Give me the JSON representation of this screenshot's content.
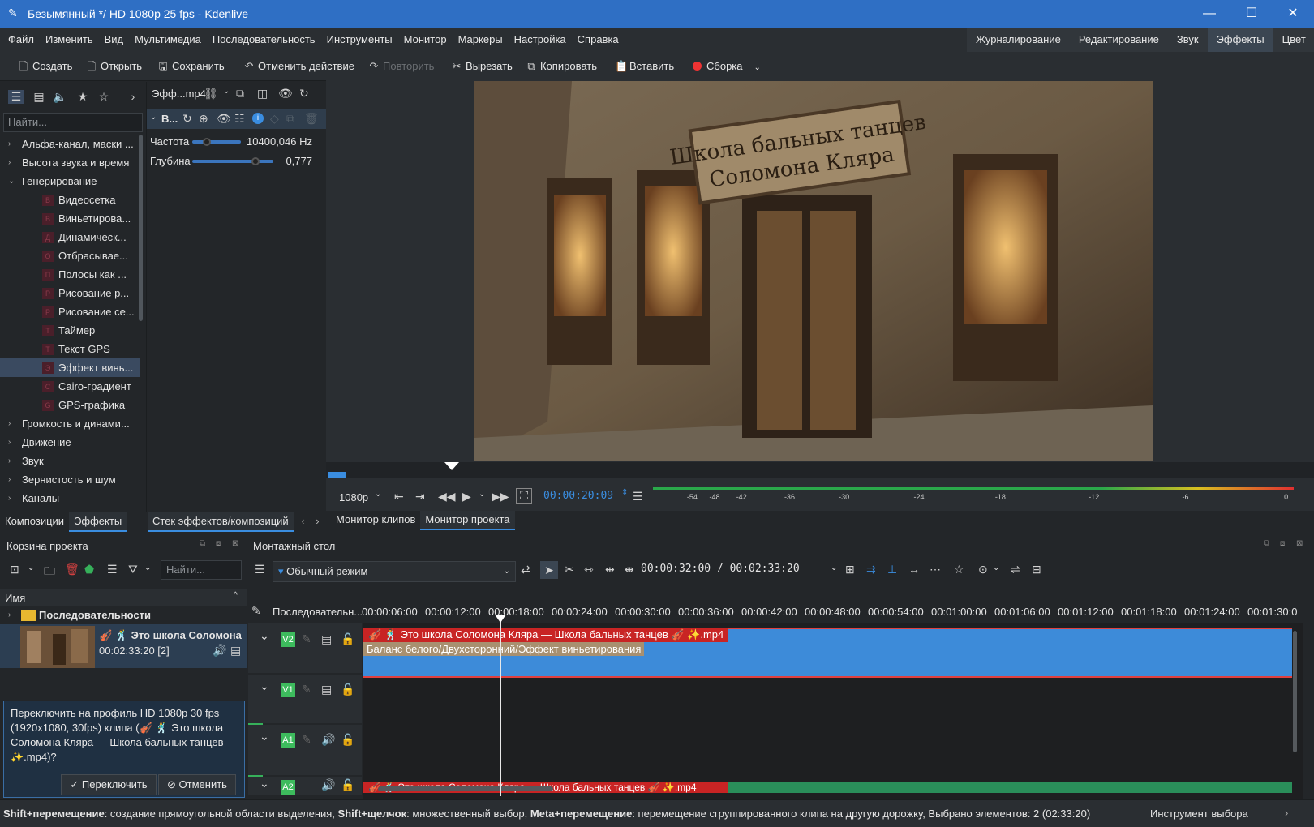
{
  "window": {
    "title": "Безымянный */ HD 1080p 25 fps - Kdenlive",
    "minimize": "—",
    "maximize": "☐",
    "close": "✕"
  },
  "menu": [
    "Файл",
    "Изменить",
    "Вид",
    "Мультимедиа",
    "Последовательность",
    "Инструменты",
    "Монитор",
    "Маркеры",
    "Настройка",
    "Справка"
  ],
  "layouts": [
    "Журналирование",
    "Редактирование",
    "Звук",
    "Эффекты",
    "Цвет"
  ],
  "active_layout": "Эффекты",
  "toolbar": {
    "new": "Создать",
    "open": "Открыть",
    "save": "Сохранить",
    "undo": "Отменить действие",
    "redo": "Повторить",
    "cut": "Вырезать",
    "copy": "Копировать",
    "paste": "Вставить",
    "render": "Сборка"
  },
  "effects": {
    "search_placeholder": "Найти...",
    "tree": [
      {
        "label": "Альфа-канал, маски ...",
        "type": "cat"
      },
      {
        "label": "Высота звука и время",
        "type": "cat"
      },
      {
        "label": "Генерирование",
        "type": "cat-open"
      },
      {
        "label": "Видеосетка",
        "type": "child",
        "badge": "В"
      },
      {
        "label": "Виньетирова...",
        "type": "child",
        "badge": "В"
      },
      {
        "label": "Динамическ...",
        "type": "child",
        "badge": "Д"
      },
      {
        "label": "Отбрасывае...",
        "type": "child",
        "badge": "О"
      },
      {
        "label": "Полосы как ...",
        "type": "child",
        "badge": "П"
      },
      {
        "label": "Рисование р...",
        "type": "child",
        "badge": "Р"
      },
      {
        "label": "Рисование се...",
        "type": "child",
        "badge": "Р"
      },
      {
        "label": "Таймер",
        "type": "child",
        "badge": "Т"
      },
      {
        "label": "Текст GPS",
        "type": "child",
        "badge": "Т"
      },
      {
        "label": "Эффект винь...",
        "type": "child",
        "badge": "Э",
        "selected": true
      },
      {
        "label": "Cairo-градиент",
        "type": "child",
        "badge": "C"
      },
      {
        "label": "GPS-графика",
        "type": "child",
        "badge": "G"
      },
      {
        "label": "Громкость и динами...",
        "type": "cat"
      },
      {
        "label": "Движение",
        "type": "cat"
      },
      {
        "label": "Звук",
        "type": "cat"
      },
      {
        "label": "Зернистость и шум",
        "type": "cat"
      },
      {
        "label": "Каналы",
        "type": "cat"
      }
    ],
    "tabs": [
      "Композиции",
      "Эффекты"
    ]
  },
  "stack": {
    "clip_name": "Эфф...mp4",
    "effect_name": "В...",
    "params": [
      {
        "label": "Частота",
        "value": "10400,046 Hz",
        "fraction": 0.3
      },
      {
        "label": "Глубина",
        "value": "0,777",
        "fraction": 0.78
      }
    ],
    "tab": "Стек эффектов/композиций"
  },
  "monitor": {
    "sign_line1": "Школа бальных танцев",
    "sign_line2": "Соломона Кляра",
    "resolution": "1080p",
    "timecode": "00:00:20:09",
    "meter_labels": [
      "-54",
      "-48",
      "-42",
      "-36",
      "-30",
      "-24",
      "-18",
      "-12",
      "-6",
      "0"
    ],
    "tabs": [
      "Монитор клипов",
      "Монитор проекта"
    ]
  },
  "bin": {
    "title": "Корзина проекта",
    "search_placeholder": "Найти...",
    "col_name": "Имя",
    "folder": "Последовательности",
    "clip_title": "🎻 🕺 Это школа Соломона",
    "clip_duration": "00:02:33:20 [2]",
    "message": "Переключить на профиль HD 1080p 30 fps (1920x1080, 30fps) клипа (🎻 🕺 Это школа Соломона Кляра — Школа бальных танцев ✨.mp4)?",
    "switch_btn": "Переключить",
    "cancel_btn": "Отменить"
  },
  "timeline": {
    "title": "Монтажный стол",
    "mode": "Обычный режим",
    "position": "00:00:32:00 / 00:02:33:20",
    "sequence_label": "Последовательн...",
    "ruler": [
      "00:00:06:00",
      "00:00:12:00",
      "00:00:18:00",
      "00:00:24:00",
      "00:00:30:00",
      "00:00:36:00",
      "00:00:42:00",
      "00:00:48:00",
      "00:00:54:00",
      "00:01:00:00",
      "00:01:06:00",
      "00:01:12:00",
      "00:01:18:00",
      "00:01:24:00",
      "00:01:30:0"
    ],
    "tracks": [
      "V2",
      "V1",
      "A1",
      "A2"
    ],
    "clip_label": "🎻 🕺 Это школа Соломона Кляра — Школа бальных танцев 🎻 ✨.mp4",
    "clip_effects": "Баланс белого/Двухсторонний/Эффект виньетирования",
    "audio_clip_label": "🎻 🕺 Это школа Соломона Кляра — Школа бальных танцев 🎻 ✨.mp4"
  },
  "status": {
    "k1": "Shift+перемещение",
    "t1": ": создание прямоугольной области выделения, ",
    "k2": "Shift+щелчок",
    "t2": ": множественный выбор, ",
    "k3": "Meta+перемещение",
    "t3": ": перемещение сгруппированного клипа на другую дорожку, Выбрано элементов: 2 (02:33:20)",
    "tool": "Инструмент выбора"
  },
  "colors": {
    "accent": "#3a8de0",
    "titlebar": "#2f6fc4",
    "clip_blue": "#3d8bd9",
    "clip_red": "#c82424",
    "track_green": "#3dbb5d"
  }
}
